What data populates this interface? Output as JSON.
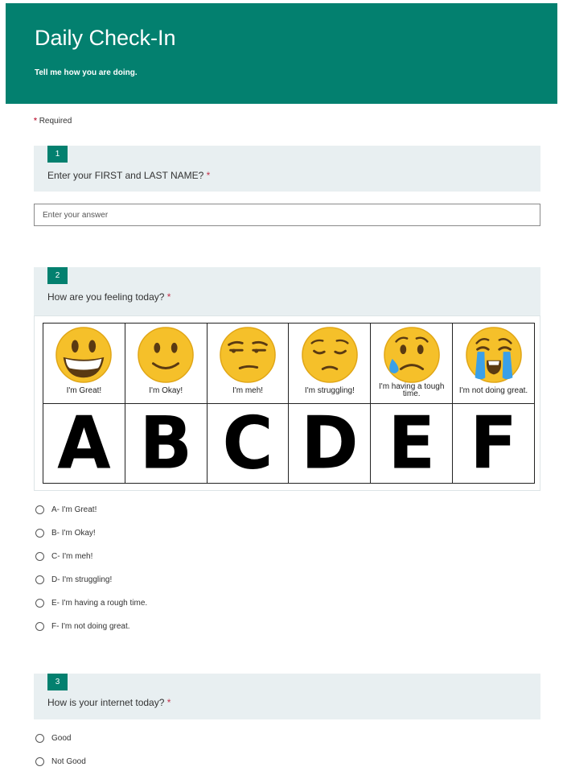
{
  "header": {
    "title": "Daily Check-In",
    "subtitle": "Tell me how you are doing."
  },
  "required_note": {
    "star": "*",
    "label": "Required"
  },
  "questions": [
    {
      "number": "1",
      "text": "Enter your FIRST and LAST NAME?",
      "required_star": "*",
      "input_placeholder": "Enter your answer",
      "input_value": ""
    },
    {
      "number": "2",
      "text": "How are you feeling today?",
      "required_star": "*",
      "emoji_grid": [
        {
          "icon": "grinning-face-icon",
          "caption": "I'm Great!",
          "letter": "A"
        },
        {
          "icon": "slightly-smiling-face-icon",
          "caption": "I'm Okay!",
          "letter": "B"
        },
        {
          "icon": "unamused-face-icon",
          "caption": "I'm meh!",
          "letter": "C"
        },
        {
          "icon": "pensive-face-icon",
          "caption": "I'm struggling!",
          "letter": "D"
        },
        {
          "icon": "sad-sweat-face-icon",
          "caption": "I'm having a tough time.",
          "letter": "E"
        },
        {
          "icon": "crying-face-icon",
          "caption": "I'm not doing great.",
          "letter": "F"
        }
      ],
      "options": [
        "A- I'm Great!",
        "B- I'm Okay!",
        "C- I'm meh!",
        "D- I'm struggling!",
        "E- I'm having a rough time.",
        "F- I'm not doing great."
      ]
    },
    {
      "number": "3",
      "text": "How is your internet today?",
      "required_star": "*",
      "options": [
        "Good",
        "Not Good"
      ]
    }
  ],
  "colors": {
    "brand": "#03806f",
    "question_bg": "#e8eff1",
    "required_star": "#c4314b",
    "emoji_yellow": "#f5c02a"
  }
}
